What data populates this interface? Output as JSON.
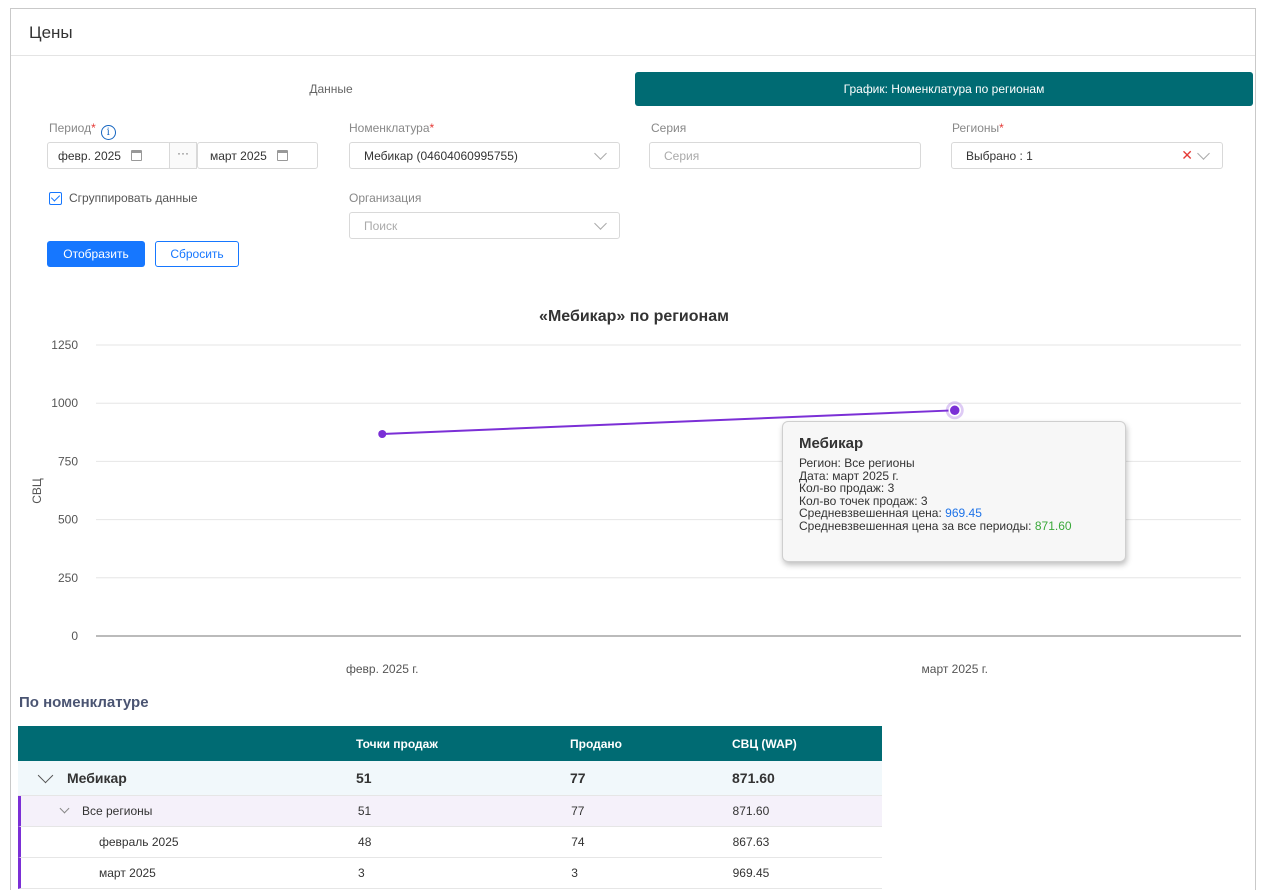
{
  "page": {
    "title": "Цены"
  },
  "tabs": [
    {
      "label": "Данные",
      "active": false
    },
    {
      "label": "График: Номенклатура по регионам",
      "active": true
    }
  ],
  "filters": {
    "period": {
      "label": "Период",
      "from": "февр. 2025",
      "sep": "···",
      "to": "март 2025"
    },
    "nomenclature": {
      "label": "Номенклатура",
      "value": "Мебикар (04604060995755)"
    },
    "series": {
      "label": "Серия",
      "placeholder": "Серия"
    },
    "regions": {
      "label": "Регионы",
      "value": "Выбрано : 1"
    },
    "organization": {
      "label": "Организация",
      "placeholder": "Поиск"
    },
    "group_data": {
      "label": "Сгруппировать данные",
      "checked": true
    }
  },
  "buttons": {
    "show": "Отобразить",
    "reset": "Сбросить"
  },
  "chart_data": {
    "type": "line",
    "title": "«Мебикар» по регионам",
    "ylabel": "СВЦ",
    "xlabel": "",
    "categories": [
      "февр. 2025 г.",
      "март 2025 г."
    ],
    "series": [
      {
        "values": [
          867.63,
          969.45
        ],
        "color": "#7b2fd6"
      }
    ],
    "ylim": [
      0,
      1250
    ],
    "yticks": [
      "0",
      "250",
      "500",
      "750",
      "1000",
      "1250"
    ],
    "grid": true
  },
  "tooltip": {
    "title": "Мебикар",
    "region": "Регион: Все регионы",
    "date": "Дата: март 2025 г.",
    "sales_count": "Кол-во продаж: 3",
    "points_count": "Кол-во точек продаж: 3",
    "wap_label": "Средневзвешенная цена:",
    "wap_value": "969.45",
    "wap_all_label": "Средневзвешенная цена за все периоды:",
    "wap_all_value": "871.60"
  },
  "table": {
    "title": "По номенклатуре",
    "headers": [
      "",
      "Точки продаж",
      "Продано",
      "СВЦ (WAP)"
    ],
    "group": {
      "name": "Мебикар",
      "points": "51",
      "sold": "77",
      "wap": "871.60"
    },
    "sub": {
      "name": "Все регионы",
      "points": "51",
      "sold": "77",
      "wap": "871.60"
    },
    "rows": [
      {
        "name": "февраль 2025",
        "points": "48",
        "sold": "74",
        "wap": "867.63"
      },
      {
        "name": "март 2025",
        "points": "3",
        "sold": "3",
        "wap": "969.45"
      }
    ]
  },
  "colors": {
    "accent": "#006b73",
    "primary": "#1677ff",
    "series": "#7b2fd6",
    "required": "#e53935"
  }
}
